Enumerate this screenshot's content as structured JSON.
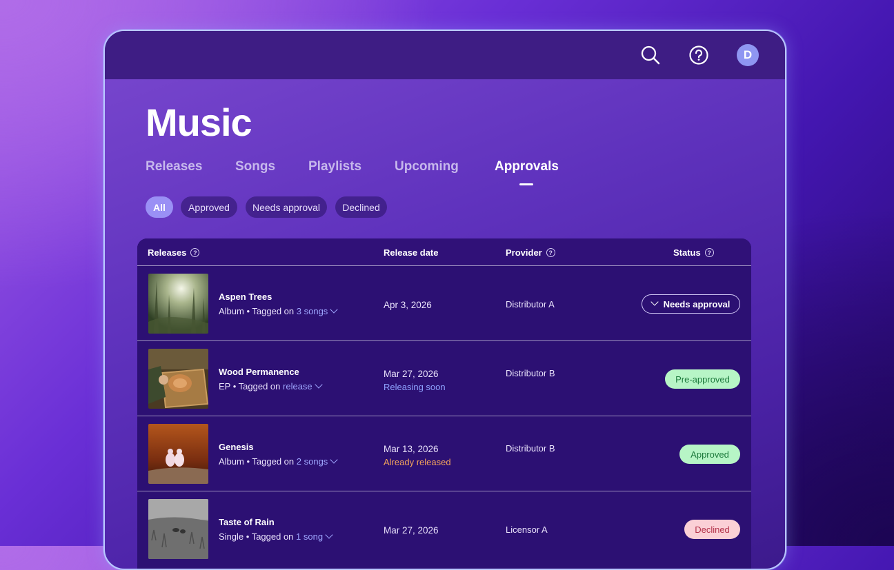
{
  "header": {
    "icons": [
      "search-icon",
      "help-icon"
    ],
    "avatar_letter": "D"
  },
  "page": {
    "title": "Music"
  },
  "tabs": [
    {
      "label": "Releases",
      "active": false
    },
    {
      "label": "Songs",
      "active": false
    },
    {
      "label": "Playlists",
      "active": false
    },
    {
      "label": "Upcoming",
      "active": false
    },
    {
      "label": "Approvals",
      "active": true
    }
  ],
  "filters": [
    {
      "label": "All",
      "active": true
    },
    {
      "label": "Approved",
      "active": false
    },
    {
      "label": "Needs approval",
      "active": false
    },
    {
      "label": "Declined",
      "active": false
    }
  ],
  "table": {
    "columns": {
      "releases": "Releases",
      "release_date": "Release date",
      "provider": "Provider",
      "status": "Status"
    },
    "rows": [
      {
        "title": "Aspen Trees",
        "type": "Album",
        "tagged_prefix": "• Tagged on",
        "tagged_link": "3 songs",
        "date": "Apr 3, 2026",
        "date_note": "",
        "provider": "Distributor A",
        "status": "Needs approval",
        "status_style": "outline"
      },
      {
        "title": "Wood Permanence",
        "type": "EP",
        "tagged_prefix": "• Tagged on",
        "tagged_link": "release",
        "date": "Mar 27, 2026",
        "date_note": "Releasing soon",
        "date_note_color": "#8fa3ff",
        "provider": "Distributor B",
        "status": "Pre-approved",
        "status_style": "green"
      },
      {
        "title": "Genesis",
        "type": "Album",
        "tagged_prefix": "• Tagged on",
        "tagged_link": "2 songs",
        "date": "Mar 13, 2026",
        "date_note": "Already released",
        "date_note_color": "#f2a35c",
        "provider": "Distributor B",
        "status": "Approved",
        "status_style": "green"
      },
      {
        "title": "Taste of Rain",
        "type": "Single",
        "tagged_prefix": "• Tagged on",
        "tagged_link": "1 song",
        "date": "Mar 27, 2026",
        "date_note": "",
        "provider": "Licensor A",
        "status": "Declined",
        "status_style": "red"
      }
    ]
  },
  "colors": {
    "accent": "#9a90f5",
    "link": "#9fa7ff",
    "approved_bg": "#b7f5c6",
    "declined_bg": "#fbd0d6"
  }
}
